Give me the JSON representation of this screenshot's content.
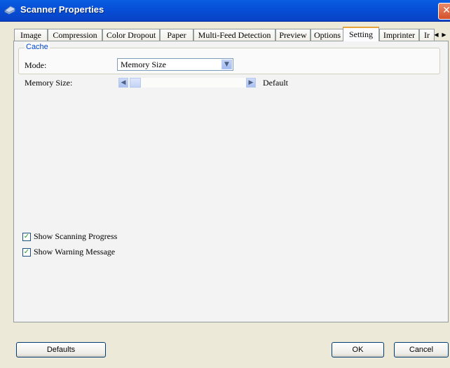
{
  "window": {
    "title": "Scanner Properties",
    "close_glyph": "✕"
  },
  "tabs": [
    {
      "label": "Image"
    },
    {
      "label": "Compression"
    },
    {
      "label": "Color Dropout"
    },
    {
      "label": "Paper"
    },
    {
      "label": "Multi-Feed Detection"
    },
    {
      "label": "Preview"
    },
    {
      "label": "Options"
    },
    {
      "label": "Setting",
      "active": true
    },
    {
      "label": "Imprinter"
    },
    {
      "label": "Ir"
    }
  ],
  "tab_scroll": {
    "left": "◀",
    "right": "▶"
  },
  "cache": {
    "legend": "Cache",
    "mode_label": "Mode:",
    "mode_value": "Memory Size",
    "memory_label": "Memory Size:",
    "memory_value": "Default",
    "slider_position": 0
  },
  "options": {
    "show_scanning_progress": {
      "label": "Show Scanning Progress",
      "checked": true
    },
    "show_warning_message": {
      "label": "Show Warning Message",
      "checked": true
    }
  },
  "buttons": {
    "defaults": "Defaults",
    "ok": "OK",
    "cancel": "Cancel"
  },
  "icons": {
    "title": "scanner-icon",
    "close": "close-icon",
    "combo": "chevron-down-icon",
    "slider_left": "arrow-left-icon",
    "slider_right": "arrow-right-icon",
    "check": "checkmark-icon"
  },
  "colors": {
    "titlebar": "#0650d8",
    "legend": "#0046d5",
    "active_tab_highlight": "#e7a23a",
    "dialog_bg": "#ece9d8"
  }
}
